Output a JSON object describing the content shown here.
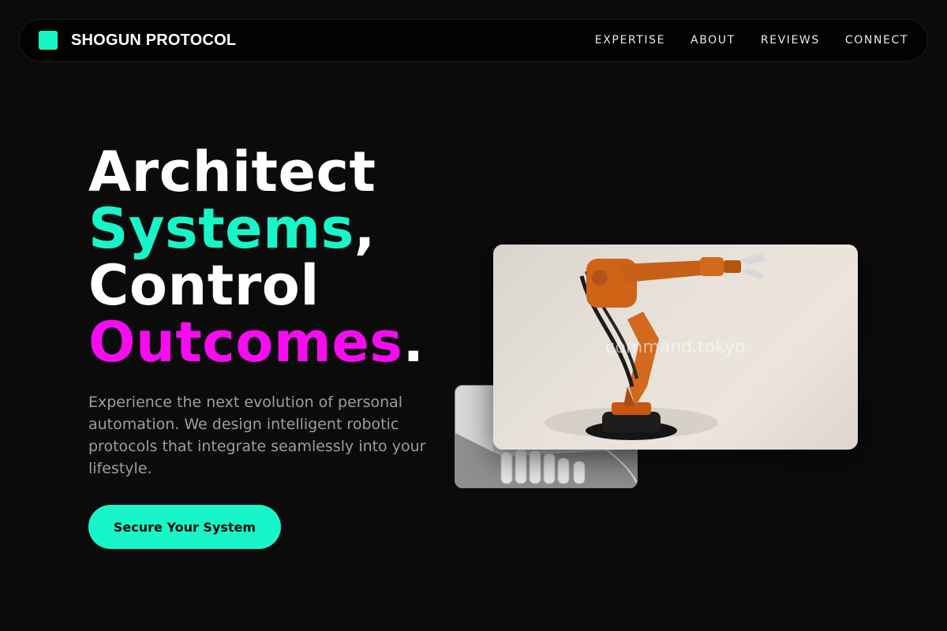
{
  "brand": {
    "name": "SHOGUN PROTOCOL",
    "accent": "#18f5c8"
  },
  "nav": {
    "links": [
      {
        "label": "EXPERTISE"
      },
      {
        "label": "ABOUT"
      },
      {
        "label": "REVIEWS"
      },
      {
        "label": "CONNECT"
      }
    ]
  },
  "hero": {
    "title_line1": "Architect",
    "title_word2": "Systems",
    "title_punct2": ",",
    "title_line3": "Control",
    "title_word4": "Outcomes",
    "title_punct4": ".",
    "description": "Experience the next evolution of personal automation. We design intelligent robotic protocols that integrate seamlessly into your lifestyle.",
    "cta_label": "Secure Your System",
    "colors": {
      "cyan": "#18f5c8",
      "magenta": "#f50cf0"
    }
  },
  "media": {
    "main_watermark": "command.tokyo",
    "main_image": "orange-robotic-arm",
    "secondary_image": "robotic-hand"
  }
}
